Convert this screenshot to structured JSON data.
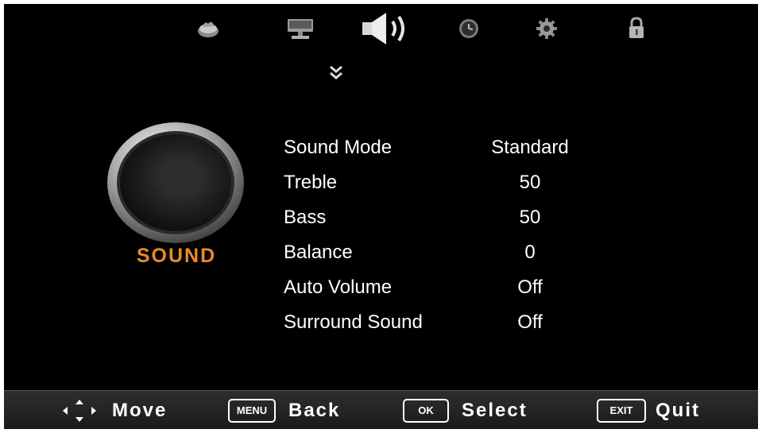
{
  "tabs": [
    {
      "name": "picture-tab",
      "icon": "picture-icon"
    },
    {
      "name": "screen-tab",
      "icon": "monitor-icon"
    },
    {
      "name": "sound-tab",
      "icon": "speaker-volume-icon",
      "active": true
    },
    {
      "name": "time-tab",
      "icon": "clock-icon"
    },
    {
      "name": "setup-tab",
      "icon": "gear-icon"
    },
    {
      "name": "lock-tab",
      "icon": "lock-icon"
    }
  ],
  "section": {
    "title": "SOUND",
    "icon": "speaker-icon",
    "color": "#e88a2e"
  },
  "menu": [
    {
      "label": "Sound Mode",
      "value": "Standard"
    },
    {
      "label": "Treble",
      "value": "50"
    },
    {
      "label": "Bass",
      "value": "50"
    },
    {
      "label": "Balance",
      "value": "0"
    },
    {
      "label": "Auto Volume",
      "value": "Off"
    },
    {
      "label": "Surround Sound",
      "value": "Off"
    }
  ],
  "footer": {
    "move": {
      "icon": "dpad-arrows-icon",
      "label": "Move"
    },
    "back": {
      "key": "MENU",
      "label": "Back"
    },
    "select": {
      "key": "OK",
      "label": "Select"
    },
    "quit": {
      "key": "EXIT",
      "label": "Quit"
    }
  }
}
